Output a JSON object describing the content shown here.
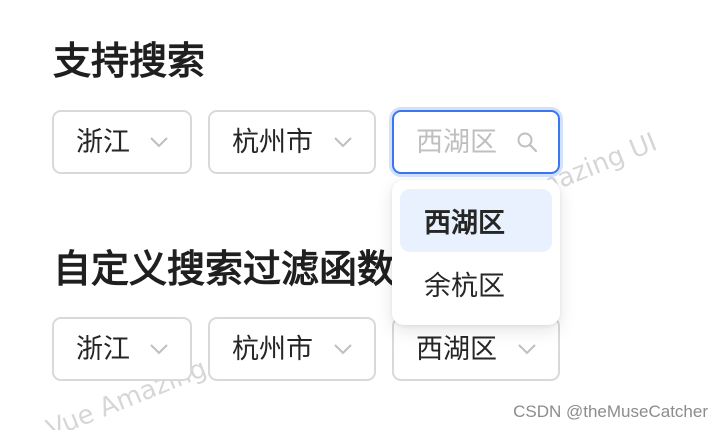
{
  "section1": {
    "title": "支持搜索",
    "province": "浙江",
    "city": "杭州市",
    "district_placeholder": "西湖区"
  },
  "dropdown": {
    "options": [
      {
        "label": "西湖区",
        "selected": true
      },
      {
        "label": "余杭区",
        "selected": false
      }
    ]
  },
  "section2": {
    "title": "自定义搜索过滤函数",
    "province": "浙江",
    "city": "杭州市",
    "district": "西湖区"
  },
  "watermark": {
    "text": "Vue Amazing UI"
  },
  "credit": {
    "text": "CSDN @theMuseCatcher"
  },
  "colors": {
    "accent": "#3a76f0",
    "selected_option_bg": "#e8f1fd",
    "border": "#d9d9d9"
  },
  "icons": {
    "select_arrow": "chevron-down-icon",
    "search": "search-icon"
  }
}
